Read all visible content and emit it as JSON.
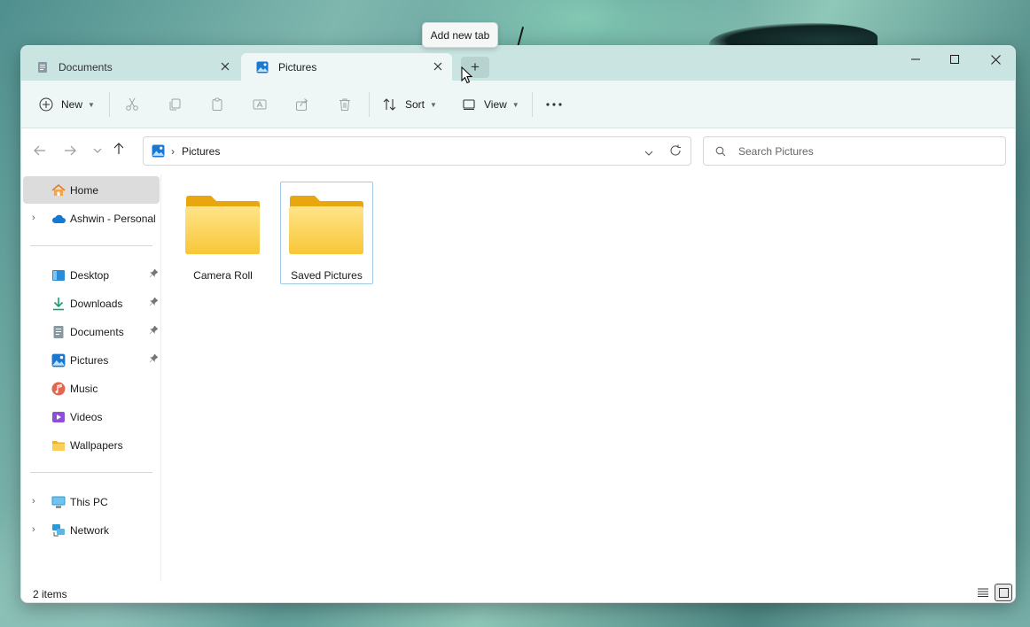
{
  "tooltip": {
    "text": "Add new tab"
  },
  "tabs": [
    {
      "label": "Documents",
      "active": false
    },
    {
      "label": "Pictures",
      "active": true
    }
  ],
  "new_tab": {
    "glyph": "+"
  },
  "toolbar": {
    "new_label": "New",
    "sort_label": "Sort",
    "view_label": "View"
  },
  "address": {
    "crumb": "Pictures"
  },
  "search": {
    "placeholder": "Search Pictures"
  },
  "sidebar": {
    "items": [
      {
        "label": "Home",
        "selected": true
      },
      {
        "label": "Ashwin - Personal"
      },
      {
        "label": "Desktop",
        "pinned": true
      },
      {
        "label": "Downloads",
        "pinned": true
      },
      {
        "label": "Documents",
        "pinned": true
      },
      {
        "label": "Pictures",
        "pinned": true
      },
      {
        "label": "Music"
      },
      {
        "label": "Videos"
      },
      {
        "label": "Wallpapers"
      },
      {
        "label": "This PC"
      },
      {
        "label": "Network"
      }
    ]
  },
  "content": {
    "folders": [
      {
        "name": "Camera Roll",
        "selected": false
      },
      {
        "name": "Saved Pictures",
        "selected": true
      }
    ]
  },
  "status": {
    "item_count": "2 items"
  },
  "colors": {
    "accent": "#0067c0",
    "folder_yellow": "#f8c737",
    "titlebar": "#c9e4e1",
    "toolbar": "#eef7f6"
  }
}
